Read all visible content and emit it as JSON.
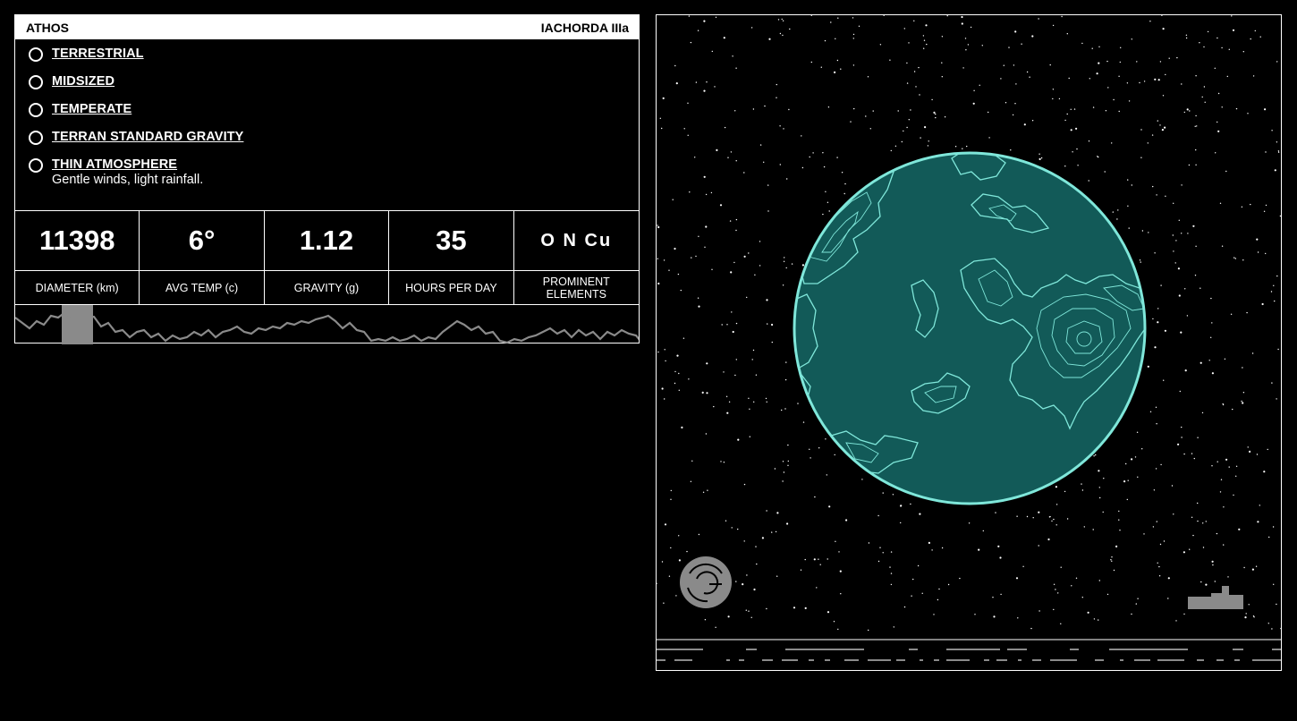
{
  "header": {
    "left_title": "ATHOS",
    "right_title": "IACHORDA IIIa"
  },
  "traits": [
    {
      "label": "TERRESTRIAL",
      "description": ""
    },
    {
      "label": "MIDSIZED",
      "description": ""
    },
    {
      "label": "TEMPERATE",
      "description": ""
    },
    {
      "label": "TERRAN STANDARD GRAVITY",
      "description": ""
    },
    {
      "label": "THIN ATMOSPHERE",
      "description": "Gentle winds, light rainfall."
    }
  ],
  "stats": [
    {
      "value": "11398",
      "label": "DIAMETER (km)"
    },
    {
      "value": "6°",
      "label": "AVG TEMP (c)"
    },
    {
      "value": "1.12",
      "label": "GRAVITY (g)"
    },
    {
      "value": "35",
      "label": "HOURS PER DAY"
    },
    {
      "value": "O N Cu",
      "label": "PROMINENT ELEMENTS"
    }
  ],
  "colors": {
    "ocean": "#125a58",
    "coast": "#7fe7da",
    "terrain_line": "#808080",
    "selection": "#8a8a8a"
  },
  "icons": {
    "planet_rotate": "rotate-icon",
    "ship": "ship-icon"
  }
}
